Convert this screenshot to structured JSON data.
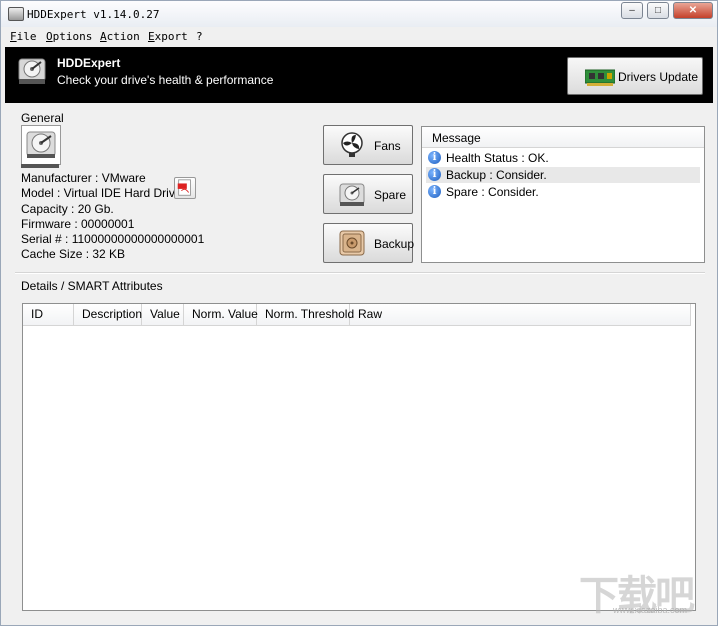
{
  "window": {
    "title": "HDDExpert v1.14.0.27",
    "controls": {
      "minimize": "‒",
      "maximize": "□",
      "close": "✕"
    }
  },
  "menu": [
    "File",
    "Options",
    "Action",
    "Export",
    "?"
  ],
  "banner": {
    "title": "HDDExpert",
    "subtitle": "Check your drive's health & performance",
    "drivers_button": "Drivers Update"
  },
  "general": {
    "label": "General",
    "info": [
      "Manufacturer : VMware",
      "Model : Virtual IDE Hard Drive",
      "Capacity : 20 Gb.",
      "Firmware : 00000001",
      "Serial # : 11000000000000000001",
      "Cache Size : 32 KB"
    ]
  },
  "actions": {
    "fans": "Fans",
    "spare": "Spare",
    "backup": "Backup"
  },
  "messages": {
    "header": "Message",
    "items": [
      "Health Status : OK.",
      "Backup : Consider.",
      "Spare : Consider."
    ],
    "selected_index": 1
  },
  "details": {
    "label": "Details / SMART Attributes",
    "columns": [
      "ID",
      "Description",
      "Value",
      "Norm. Value",
      "Norm. Threshold",
      "Raw"
    ],
    "rows": []
  },
  "watermark": {
    "text": "下载吧",
    "url": "www.xiazaiba.com"
  },
  "colors": {
    "banner_bg": "#000000",
    "info_icon": "#1f5fbf",
    "window_bg": "#f0f0f0"
  }
}
